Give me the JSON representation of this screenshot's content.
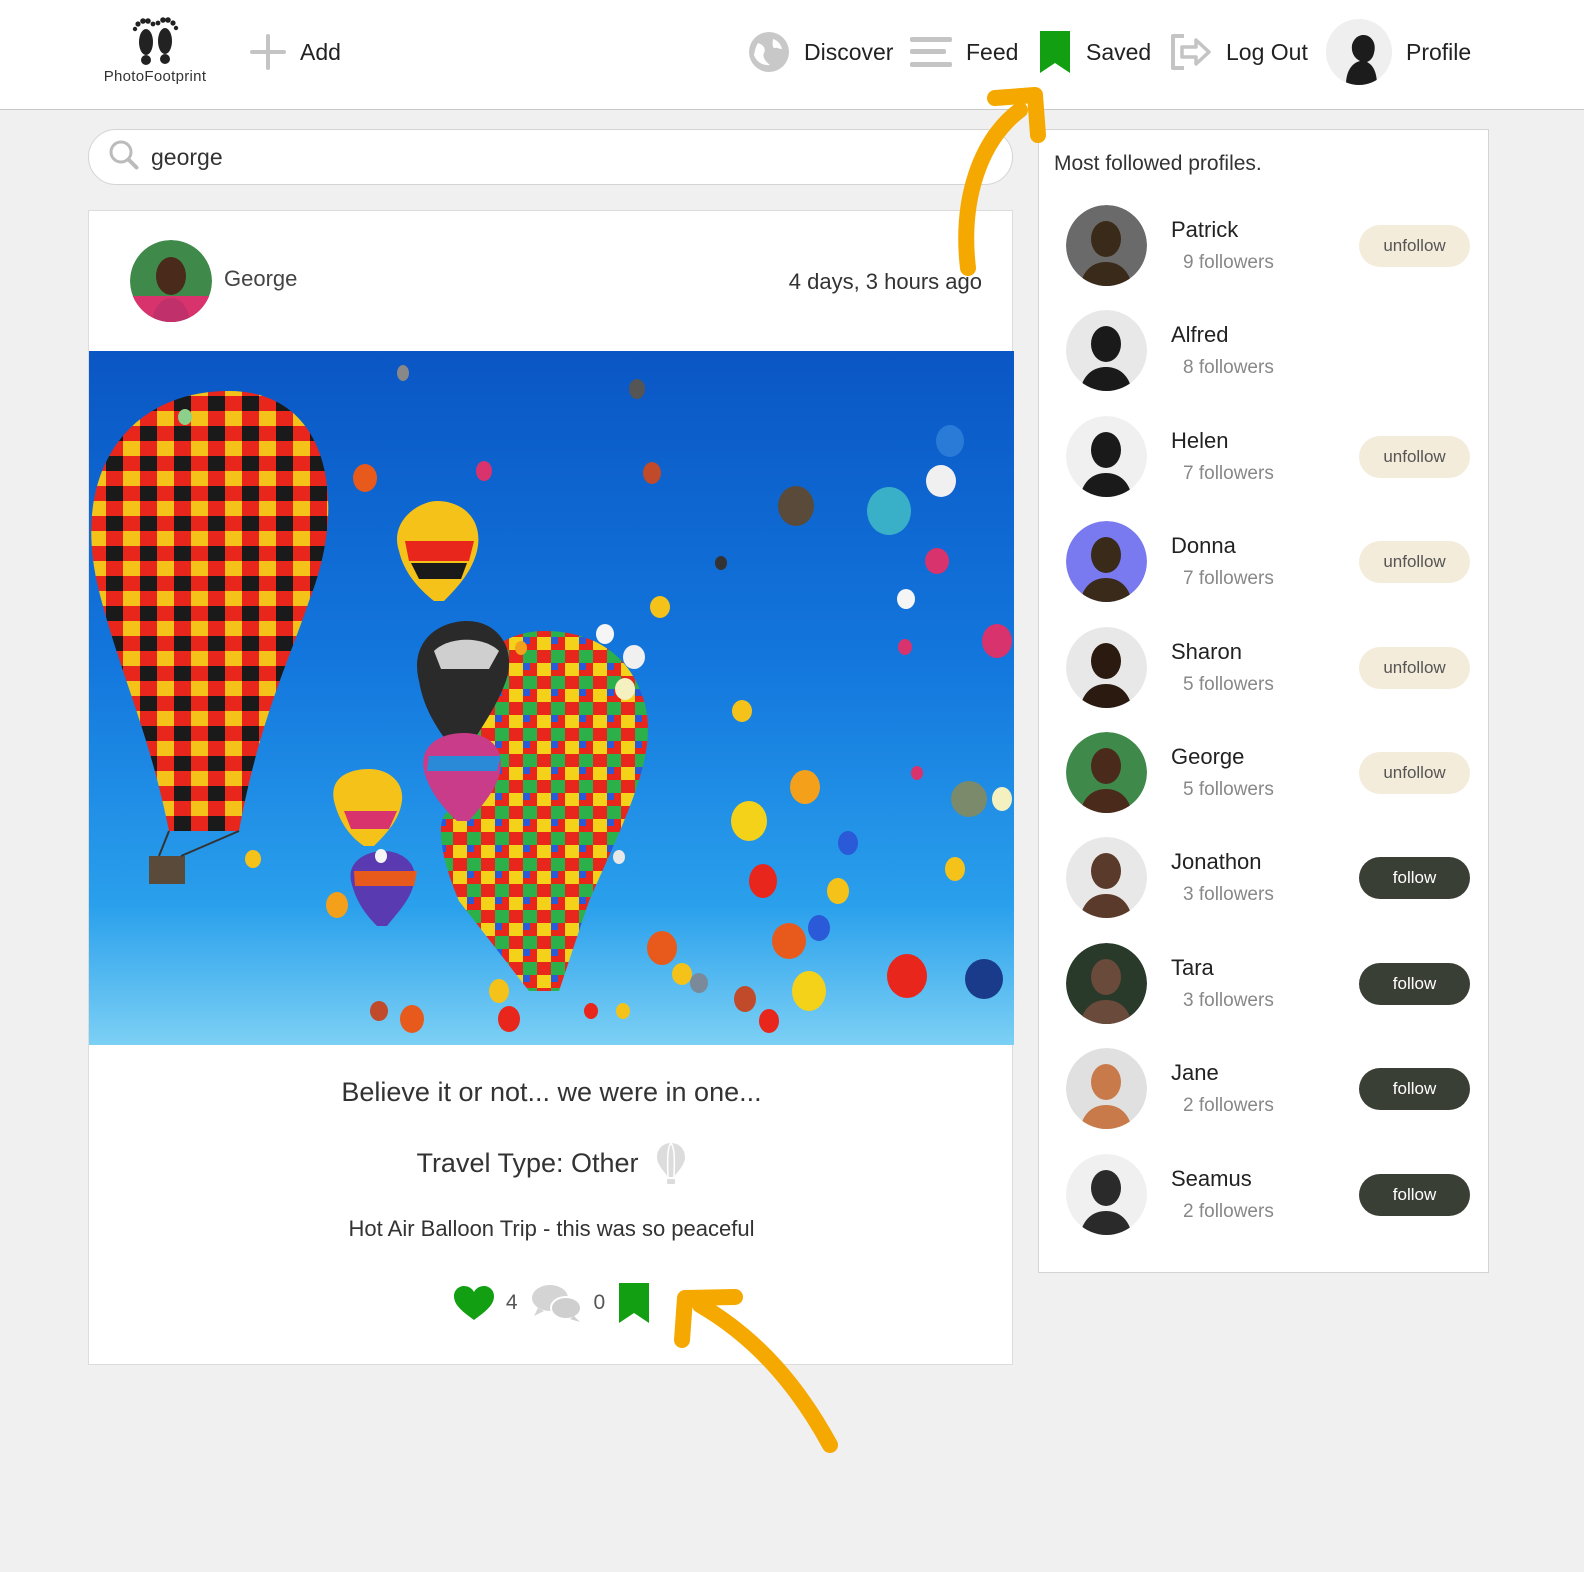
{
  "header": {
    "logo_text": "PhotoFootprint",
    "nav": {
      "add": "Add",
      "discover": "Discover",
      "feed": "Feed",
      "saved": "Saved",
      "logout": "Log Out",
      "profile": "Profile"
    }
  },
  "search": {
    "value": "george"
  },
  "post": {
    "author": "George",
    "time": "4 days, 3 hours ago",
    "caption": "Believe it or not... we were in one...",
    "travel_type": "Travel Type: Other",
    "description": "Hot Air Balloon Trip - this was so peaceful",
    "likes": "4",
    "comments": "0"
  },
  "sidebar": {
    "title": "Most followed profiles.",
    "profiles": [
      {
        "name": "Patrick",
        "followers": "9 followers",
        "action": "unfollow"
      },
      {
        "name": "Alfred",
        "followers": "8 followers",
        "action": ""
      },
      {
        "name": "Helen",
        "followers": "7 followers",
        "action": "unfollow"
      },
      {
        "name": "Donna",
        "followers": "7 followers",
        "action": "unfollow"
      },
      {
        "name": "Sharon",
        "followers": "5 followers",
        "action": "unfollow"
      },
      {
        "name": "George",
        "followers": "5 followers",
        "action": "unfollow"
      },
      {
        "name": "Jonathon",
        "followers": "3 followers",
        "action": "follow"
      },
      {
        "name": "Tara",
        "followers": "3 followers",
        "action": "follow"
      },
      {
        "name": "Jane",
        "followers": "2 followers",
        "action": "follow"
      },
      {
        "name": "Seamus",
        "followers": "2 followers",
        "action": "follow"
      }
    ]
  },
  "colors": {
    "accent_green": "#12a012",
    "annotation_orange": "#f5a800",
    "follow_button": "#3a3f35",
    "unfollow_button": "#f4ecdb"
  },
  "icons": [
    "footprints-icon",
    "plus-icon",
    "globe-icon",
    "menu-lines-icon",
    "bookmark-icon",
    "logout-icon",
    "search-icon",
    "balloon-icon",
    "heart-icon",
    "comments-icon"
  ]
}
